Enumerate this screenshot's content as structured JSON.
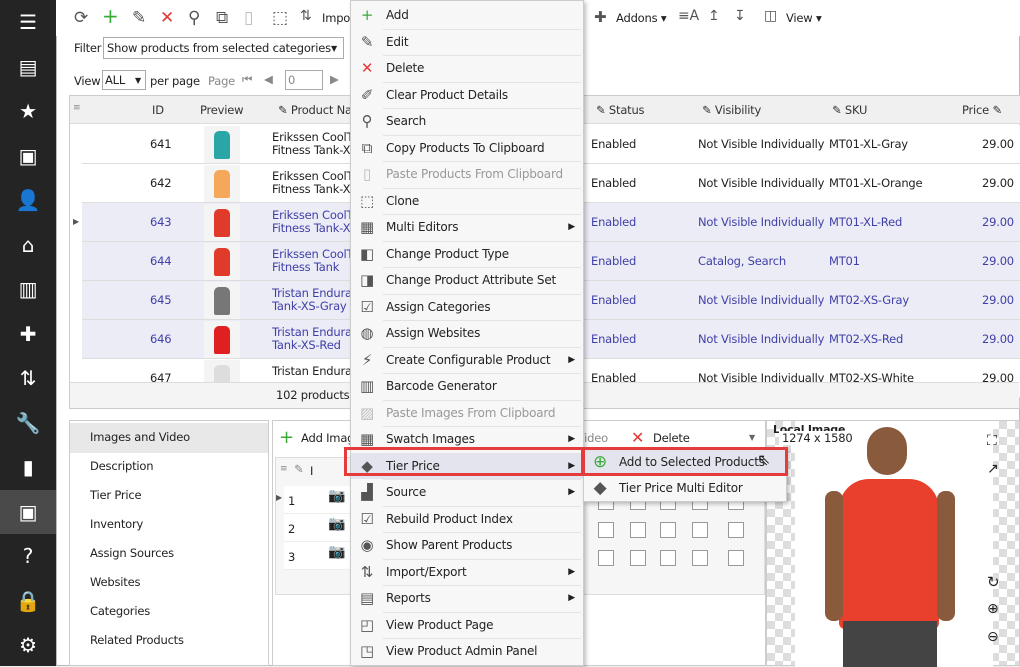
{
  "sidebar": {
    "items": [
      "menu-icon",
      "store-icon",
      "star-icon",
      "box-icon",
      "user-icon",
      "house-icon",
      "chart-icon",
      "puzzle-icon",
      "sort-icon",
      "wrench-icon",
      "slides-icon",
      "archive-icon",
      "help-icon",
      "lock-icon",
      "gear-icon"
    ]
  },
  "toolbar": {
    "import": "Impo",
    "addons": "Addons",
    "view": "View"
  },
  "filter": {
    "label": "Filter",
    "value": "Show products from selected categories"
  },
  "paging": {
    "view_label": "View",
    "per_page_value": "ALL",
    "per_page_label": "per page",
    "page_label": "Page",
    "page_value": "0"
  },
  "grid": {
    "columns": [
      "ID",
      "Preview",
      "Product Na",
      "Status",
      "Visibility",
      "SKU",
      "Price"
    ],
    "rows": [
      {
        "id": "641",
        "name1": "Erikssen CoolT",
        "name2": "Fitness Tank-XL",
        "status": "Enabled",
        "visibility": "Not Visible Individually",
        "sku": "MT01-XL-Gray",
        "price": "29.00",
        "color": "#2aa6a6",
        "selected": false
      },
      {
        "id": "642",
        "name1": "Erikssen CoolT",
        "name2": "Fitness Tank-XL",
        "status": "Enabled",
        "visibility": "Not Visible Individually",
        "sku": "MT01-XL-Orange",
        "price": "29.00",
        "color": "#f5a85a",
        "selected": false
      },
      {
        "id": "643",
        "name1": "Erikssen CoolT",
        "name2": "Fitness Tank-XL",
        "status": "Enabled",
        "visibility": "Not Visible Individually",
        "sku": "MT01-XL-Red",
        "price": "29.00",
        "color": "#e03a2a",
        "selected": true
      },
      {
        "id": "644",
        "name1": "Erikssen CoolT",
        "name2": "Fitness Tank",
        "status": "Enabled",
        "visibility": "Catalog, Search",
        "sku": "MT01",
        "price": "29.00",
        "color": "#e03a2a",
        "selected": true
      },
      {
        "id": "645",
        "name1": "Tristan Endura",
        "name2": "Tank-XS-Gray",
        "status": "Enabled",
        "visibility": "Not Visible Individually",
        "sku": "MT02-XS-Gray",
        "price": "29.00",
        "color": "#777",
        "selected": true
      },
      {
        "id": "646",
        "name1": "Tristan Endura",
        "name2": "Tank-XS-Red",
        "status": "Enabled",
        "visibility": "Not Visible Individually",
        "sku": "MT02-XS-Red",
        "price": "29.00",
        "color": "#e02020",
        "selected": true
      },
      {
        "id": "647",
        "name1": "Tristan Endura",
        "name2": "",
        "status": "Enabled",
        "visibility": "Not Visible Individually",
        "sku": "MT02-XS-White",
        "price": "29.00",
        "color": "#ddd",
        "selected": false
      }
    ],
    "footer": "102 products"
  },
  "details": {
    "items": [
      "Images and Video",
      "Description",
      "Tier Price",
      "Inventory",
      "Assign Sources",
      "Websites",
      "Categories",
      "Related Products"
    ],
    "active": 0
  },
  "images": {
    "add_label": "Add Imag",
    "video_label": "t Video",
    "delete_label": "Delete",
    "col_label": "I",
    "rows": [
      "1",
      "2",
      "3"
    ]
  },
  "preview": {
    "title": "Local Image",
    "size": "1274 x 1580"
  },
  "context_menu": {
    "items": [
      {
        "label": "Add",
        "icon": "plus-icon"
      },
      {
        "label": "Edit",
        "icon": "pencil-icon"
      },
      {
        "label": "Delete",
        "icon": "x-icon"
      },
      {
        "label": "Clear Product Details",
        "icon": "eraser-icon"
      },
      {
        "label": "Search",
        "icon": "search-icon"
      },
      {
        "label": "Copy Products To Clipboard",
        "icon": "copy-icon"
      },
      {
        "label": "Paste Products From Clipboard",
        "icon": "paste-icon",
        "disabled": true
      },
      {
        "label": "Clone",
        "icon": "clone-icon"
      },
      {
        "label": "Multi Editors",
        "icon": "multi-edit-icon",
        "submenu": true
      },
      {
        "label": "Change Product Type",
        "icon": "type-icon"
      },
      {
        "label": "Change Product Attribute Set",
        "icon": "attribute-icon"
      },
      {
        "label": "Assign Categories",
        "icon": "categories-icon"
      },
      {
        "label": "Assign Websites",
        "icon": "globe-icon"
      },
      {
        "label": "Create Configurable Product",
        "icon": "lightning-icon",
        "submenu": true
      },
      {
        "label": "Barcode Generator",
        "icon": "barcode-icon"
      },
      {
        "label": "Paste Images From Clipboard",
        "icon": "paste-image-icon",
        "disabled": true
      },
      {
        "label": "Swatch Images",
        "icon": "swatch-icon",
        "submenu": true
      },
      {
        "label": "Tier Price",
        "icon": "tag-icon",
        "submenu": true,
        "highlighted": true
      },
      {
        "label": "Source",
        "icon": "source-icon",
        "submenu": true
      },
      {
        "label": "Rebuild Product Index",
        "icon": "rebuild-icon"
      },
      {
        "label": "Show Parent Products",
        "icon": "parent-icon"
      },
      {
        "label": "Import/Export",
        "icon": "import-export-icon",
        "submenu": true
      },
      {
        "label": "Reports",
        "icon": "reports-icon",
        "submenu": true
      },
      {
        "label": "View Product Page",
        "icon": "view-page-icon"
      },
      {
        "label": "View Product Admin Panel",
        "icon": "admin-panel-icon"
      }
    ]
  },
  "submenu": {
    "items": [
      {
        "label": "Add to Selected Products",
        "icon": "plus-circle-icon"
      },
      {
        "label": "Tier Price Multi Editor",
        "icon": "tag-icon"
      }
    ]
  },
  "colors": {
    "sidebar": "#242424",
    "selected_text": "#3f3fa8",
    "highlight": "#e53b3b",
    "add_green": "#3aaa3a",
    "delete_red": "#e53935"
  }
}
